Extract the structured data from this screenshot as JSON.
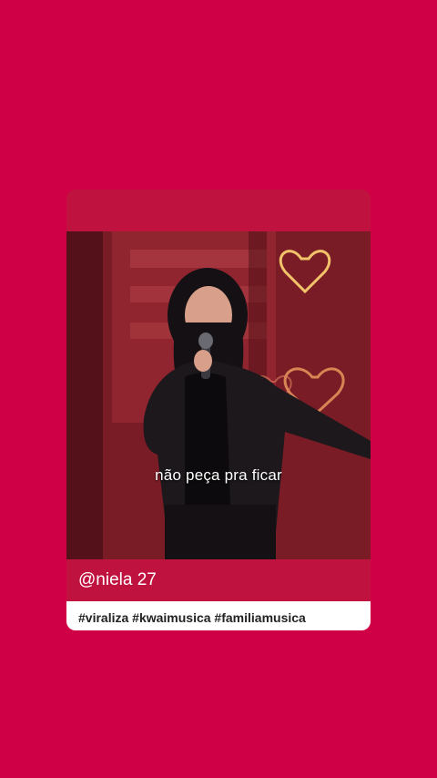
{
  "video": {
    "subtitle": "não peça pra ficar"
  },
  "post": {
    "username": "@niela 27",
    "hashtags": "#viraliza #kwaimusica #familiamusica"
  },
  "colors": {
    "background": "#cf0046",
    "card_band": "#c0123e",
    "tag_band": "#ffffff"
  }
}
